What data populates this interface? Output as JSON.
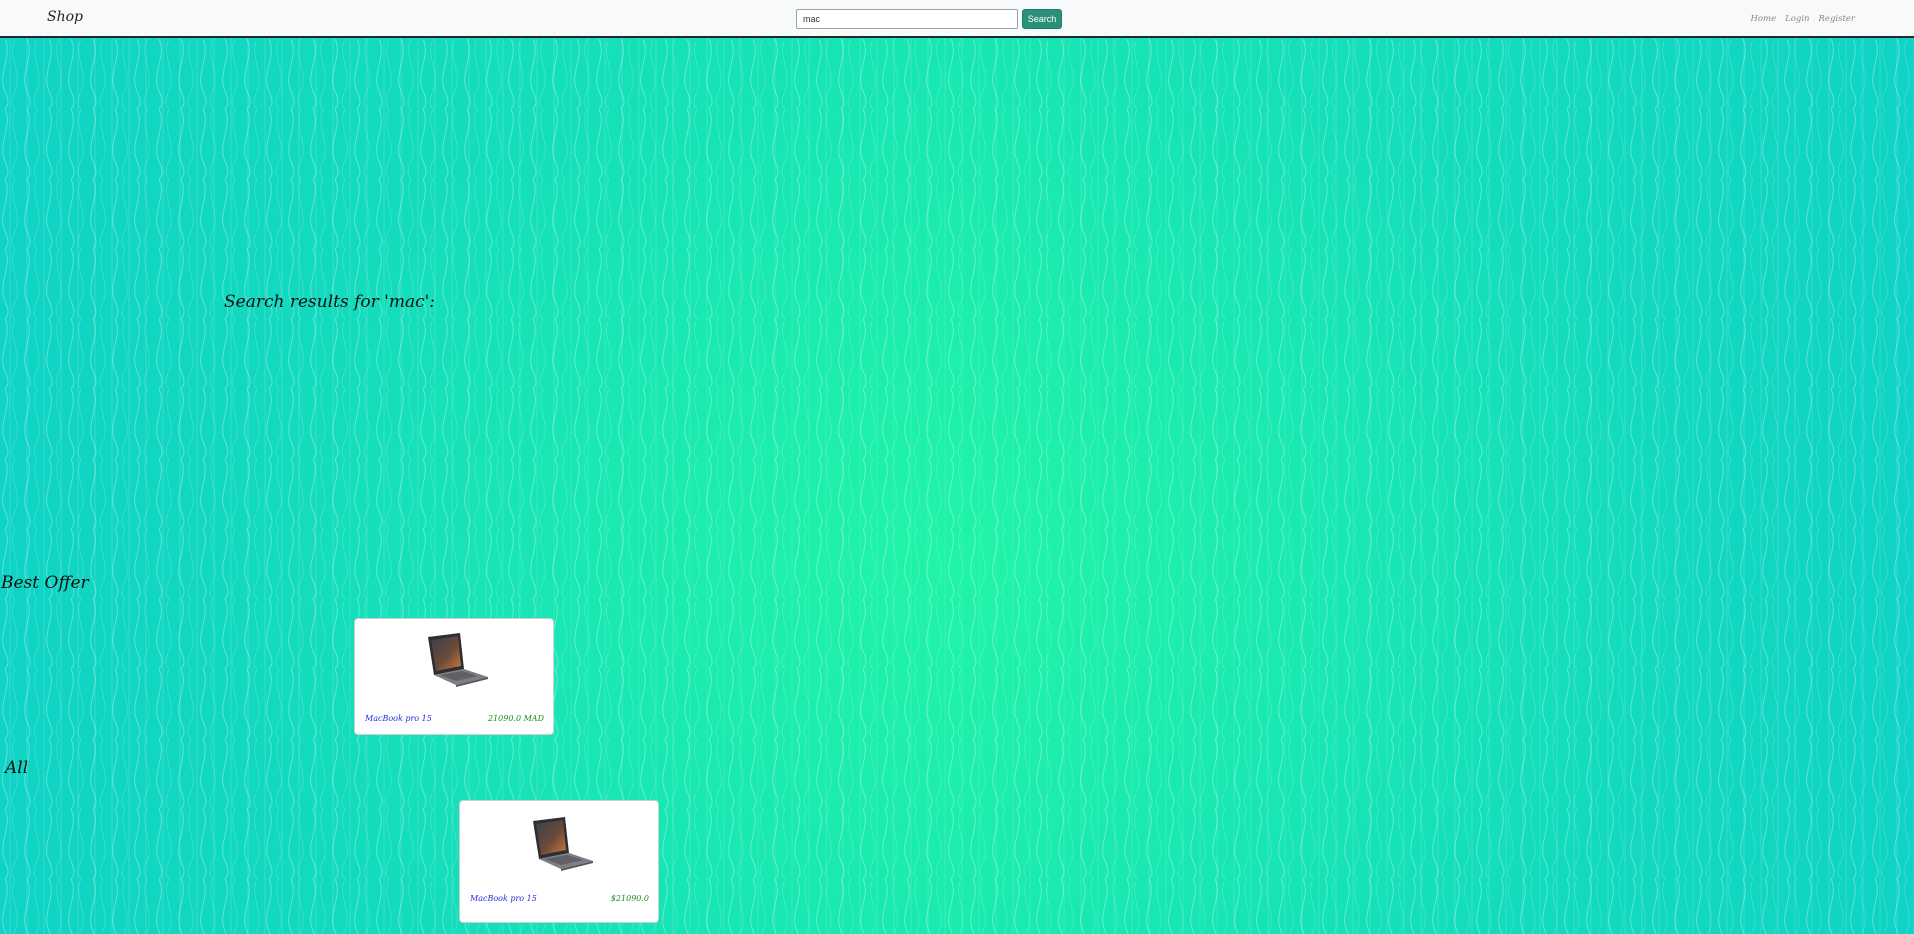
{
  "navbar": {
    "brand": "Shop",
    "search": {
      "value": "mac",
      "placeholder": ""
    },
    "search_button": "Search",
    "links": [
      "Home",
      "Login",
      "Register"
    ]
  },
  "main": {
    "results_heading": "Search results for 'mac':",
    "best_offer": {
      "heading": "Best Offer",
      "items": [
        {
          "name": "MacBook pro 15",
          "price": "21090.0 MAD",
          "image_icon": "laptop-icon"
        }
      ]
    },
    "all": {
      "heading": "All",
      "items": [
        {
          "name": "MacBook pro 15",
          "price": "$21090.0",
          "image_icon": "laptop-icon"
        }
      ]
    }
  },
  "colors": {
    "background": "#14dcb8",
    "navbar": "#f8f9fa",
    "search_button": "#2a9079",
    "product_name": "#2a2ad8",
    "price": "#1f8a1f"
  }
}
